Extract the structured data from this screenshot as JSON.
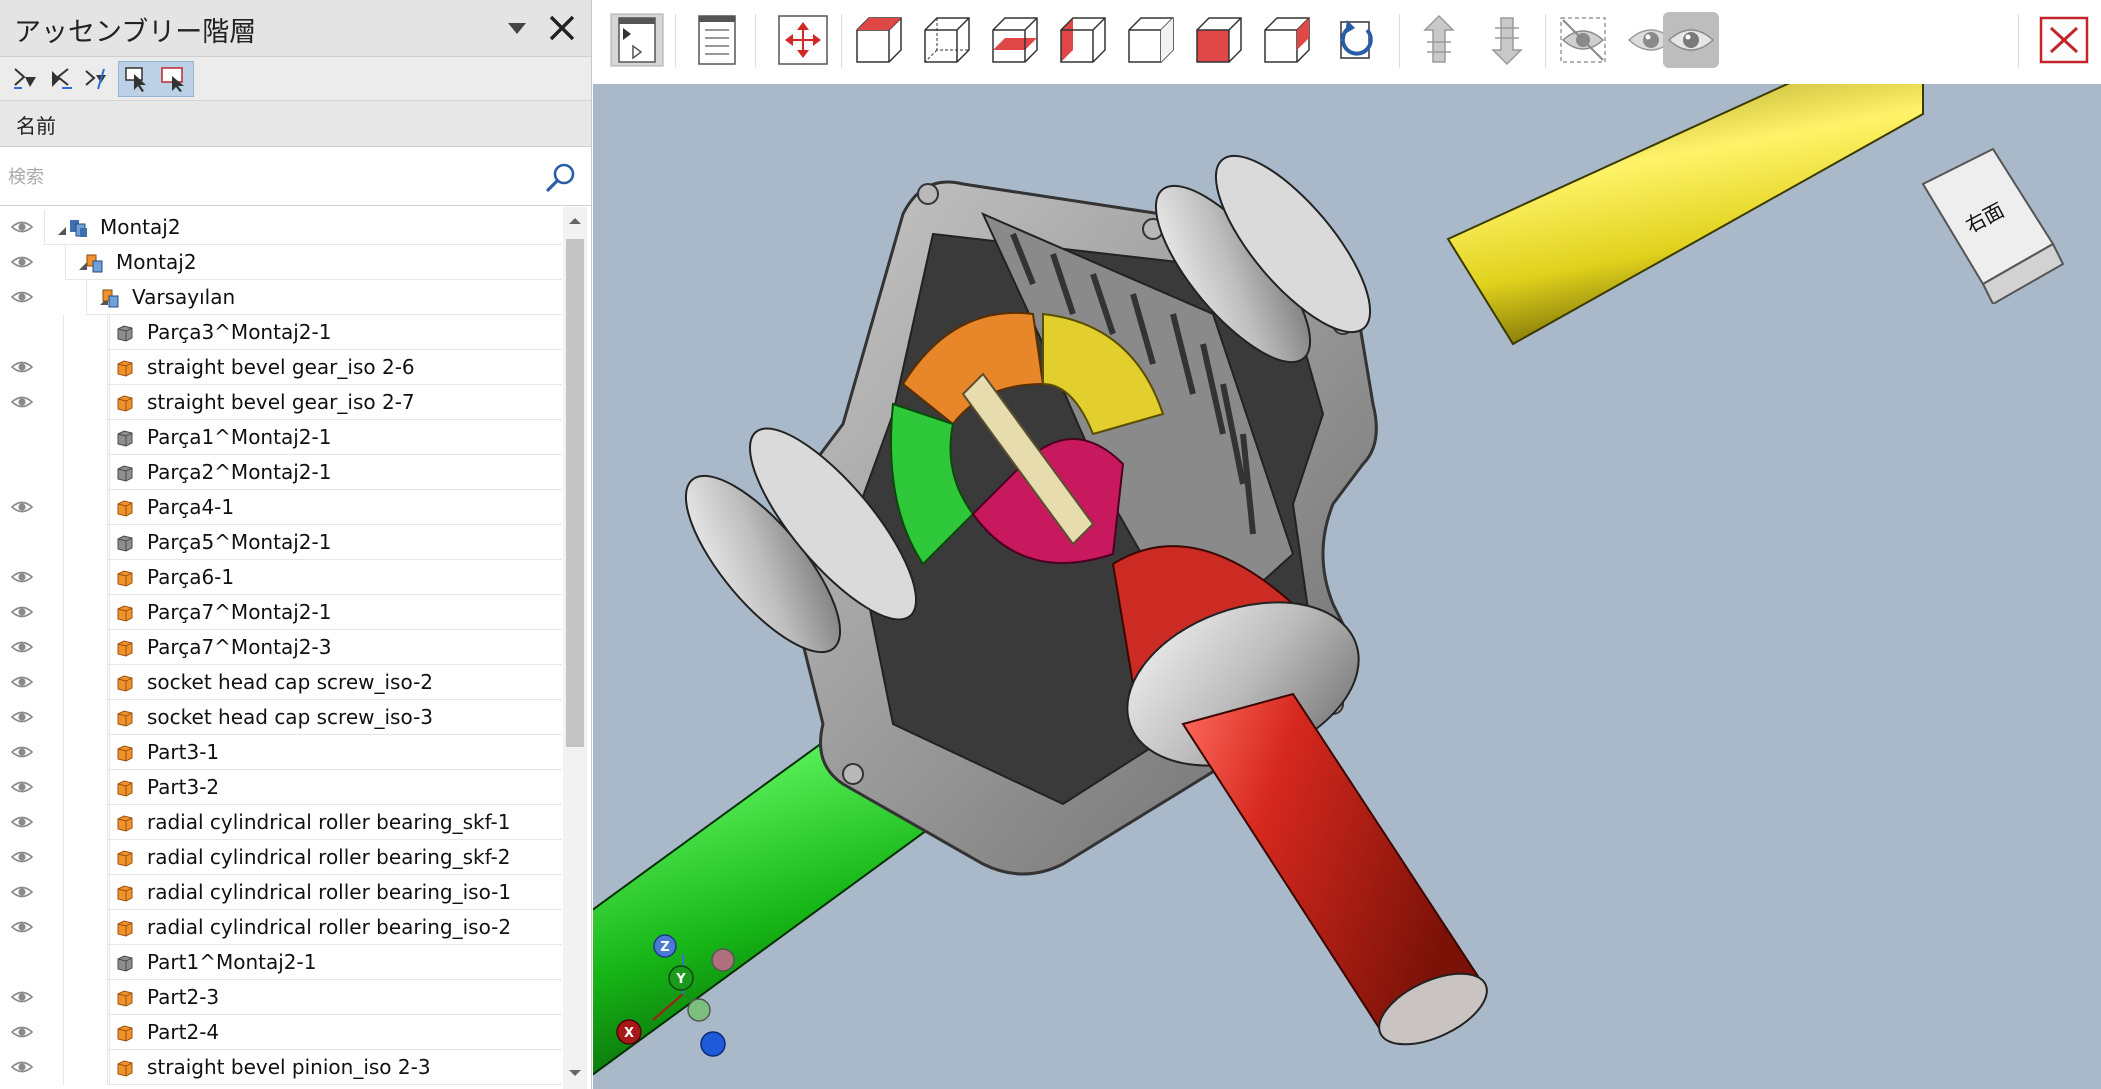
{
  "panel": {
    "title": "アッセンブリー階層",
    "column_header": "名前",
    "search_placeholder": "検索"
  },
  "tree": [
    {
      "label": "Montaj2",
      "level": 0,
      "icon": "assembly-icon",
      "eye": true,
      "expanded": true
    },
    {
      "label": "Montaj2",
      "level": 1,
      "icon": "subassembly-icon",
      "eye": true,
      "expanded": true
    },
    {
      "label": "Varsayılan",
      "level": 2,
      "icon": "subassembly-icon",
      "eye": true,
      "expanded": true
    },
    {
      "label": "Parça3^Montaj2-1",
      "level": 3,
      "icon": "part-gray-icon",
      "eye": false
    },
    {
      "label": "straight bevel gear_iso 2-6",
      "level": 3,
      "icon": "part-orange-icon",
      "eye": true
    },
    {
      "label": "straight bevel gear_iso 2-7",
      "level": 3,
      "icon": "part-orange-icon",
      "eye": true
    },
    {
      "label": "Parça1^Montaj2-1",
      "level": 3,
      "icon": "part-gray-icon",
      "eye": false
    },
    {
      "label": "Parça2^Montaj2-1",
      "level": 3,
      "icon": "part-gray-icon",
      "eye": false
    },
    {
      "label": "Parça4-1",
      "level": 3,
      "icon": "part-orange-icon",
      "eye": true
    },
    {
      "label": "Parça5^Montaj2-1",
      "level": 3,
      "icon": "part-gray-icon",
      "eye": false
    },
    {
      "label": "Parça6-1",
      "level": 3,
      "icon": "part-orange-icon",
      "eye": true
    },
    {
      "label": "Parça7^Montaj2-1",
      "level": 3,
      "icon": "part-orange-icon",
      "eye": true
    },
    {
      "label": "Parça7^Montaj2-3",
      "level": 3,
      "icon": "part-orange-icon",
      "eye": true
    },
    {
      "label": "socket head cap screw_iso-2",
      "level": 3,
      "icon": "part-orange-icon",
      "eye": true
    },
    {
      "label": "socket head cap screw_iso-3",
      "level": 3,
      "icon": "part-orange-icon",
      "eye": true
    },
    {
      "label": "Part3-1",
      "level": 3,
      "icon": "part-orange-icon",
      "eye": true
    },
    {
      "label": "Part3-2",
      "level": 3,
      "icon": "part-orange-icon",
      "eye": true
    },
    {
      "label": "radial cylindrical roller bearing_skf-1",
      "level": 3,
      "icon": "part-orange-icon",
      "eye": true
    },
    {
      "label": "radial cylindrical roller bearing_skf-2",
      "level": 3,
      "icon": "part-orange-icon",
      "eye": true
    },
    {
      "label": "radial cylindrical roller bearing_iso-1",
      "level": 3,
      "icon": "part-orange-icon",
      "eye": true
    },
    {
      "label": "radial cylindrical roller bearing_iso-2",
      "level": 3,
      "icon": "part-orange-icon",
      "eye": true
    },
    {
      "label": "Part1^Montaj2-1",
      "level": 3,
      "icon": "part-gray-icon",
      "eye": false
    },
    {
      "label": "Part2-3",
      "level": 3,
      "icon": "part-orange-icon",
      "eye": true
    },
    {
      "label": "Part2-4",
      "level": 3,
      "icon": "part-orange-icon",
      "eye": true
    },
    {
      "label": "straight bevel pinion_iso 2-3",
      "level": 3,
      "icon": "part-orange-icon",
      "eye": true
    }
  ],
  "view_cube": {
    "face_label": "右面"
  },
  "triad": {
    "x": "X",
    "y": "Y",
    "z": "Z"
  },
  "colors": {
    "viewport_bg": "#a9b9c9",
    "shaft_yellow": "#e0d21c",
    "shaft_green": "#16b516",
    "shaft_red": "#c8231d",
    "part_orange": "#f0922c",
    "assembly_blue": "#3d6fb0",
    "close_red": "#c0262a"
  }
}
